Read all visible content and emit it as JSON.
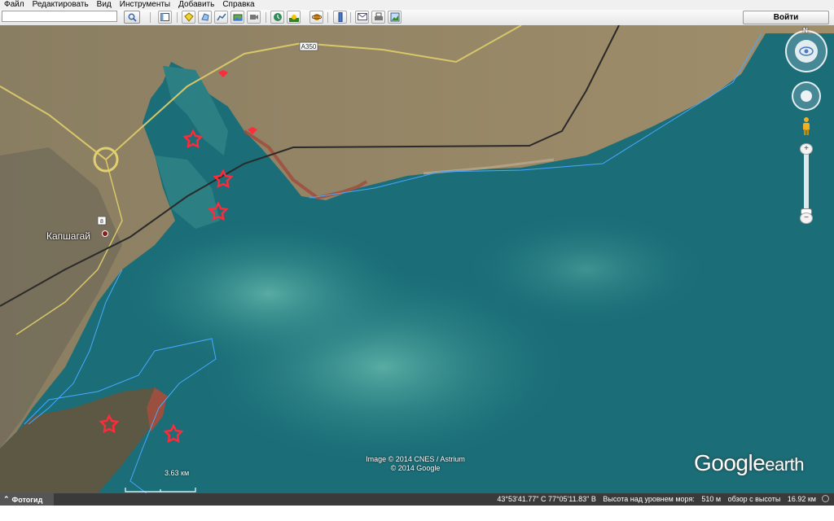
{
  "menu": [
    {
      "label": "Файл"
    },
    {
      "label": "Редактировать"
    },
    {
      "label": "Вид"
    },
    {
      "label": "Инструменты"
    },
    {
      "label": "Добавить"
    },
    {
      "label": "Справка"
    }
  ],
  "toolbar": {
    "search_value": "",
    "signin_label": "Войти",
    "buttons": [
      "sidebar-toggle-icon",
      "placemark-icon",
      "polygon-icon",
      "path-icon",
      "image-overlay-icon",
      "record-tour-icon",
      "historical-imagery-icon",
      "sunlight-icon",
      "planets-icon",
      "ruler-icon",
      "email-icon",
      "print-icon",
      "save-image-icon"
    ]
  },
  "map": {
    "city_label": "Капшагай",
    "road_label": "A350",
    "highway_shield": "8",
    "attribution_line1": "Image © 2014 CNES / Astrium",
    "attribution_line2": "© 2014 Google",
    "logo_main": "Google",
    "logo_sub": "earth",
    "scale_label": "3.63 км",
    "north_label": "N",
    "markers": [
      "star",
      "star",
      "star",
      "star",
      "star",
      "star"
    ],
    "colors": {
      "water": "#1f7a80",
      "land": "#8d7d5c",
      "marker": "#ff2a3a",
      "boundary": "#4aa8ff"
    }
  },
  "navigation": {
    "zoom_in": "+",
    "zoom_out": "−",
    "zoom_level": 0.45
  },
  "status": {
    "tour_label": "Фотогид",
    "coords": "43°53'41.77\" С   77°05'11.83\" В",
    "elevation_label": "Высота над уровнем моря:",
    "elevation_value": "510 м",
    "eye_label": "обзор с высоты",
    "eye_value": "16.92 км"
  }
}
